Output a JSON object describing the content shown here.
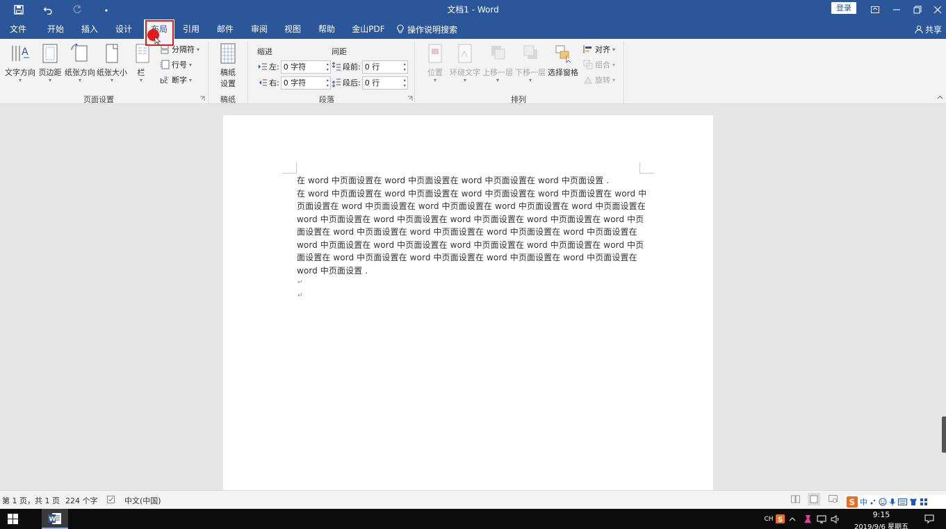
{
  "window": {
    "title": "文档1  -  Word",
    "login_label": "登录"
  },
  "menu_tabs": [
    {
      "label": "文件"
    },
    {
      "label": "开始"
    },
    {
      "label": "插入"
    },
    {
      "label": "设计"
    },
    {
      "label": "布局"
    },
    {
      "label": "引用"
    },
    {
      "label": "邮件"
    },
    {
      "label": "审阅"
    },
    {
      "label": "视图"
    },
    {
      "label": "帮助"
    },
    {
      "label": "金山PDF"
    }
  ],
  "tell_me": "操作说明搜索",
  "share": "共享",
  "ribbon": {
    "page_setup": {
      "group_label": "页面设置",
      "text_direction": "文字方向",
      "margins": "页边距",
      "orientation": "纸张方向",
      "size": "纸张大小",
      "columns": "栏",
      "breaks": "分隔符",
      "line_numbers": "行号",
      "hyphenation": "断字"
    },
    "manuscript": {
      "group_label": "稿纸",
      "button_line1": "稿纸",
      "button_line2": "设置"
    },
    "paragraph": {
      "group_label": "段落",
      "indent_heading": "缩进",
      "spacing_heading": "间距",
      "left_label": "左:",
      "left_value": "0 字符",
      "right_label": "右:",
      "right_value": "0 字符",
      "before_label": "段前:",
      "before_value": "0 行",
      "after_label": "段后:",
      "after_value": "0 行"
    },
    "arrange": {
      "group_label": "排列",
      "position": "位置",
      "wrap_text": "环绕文字",
      "bring_forward": "上移一层",
      "send_backward": "下移一层",
      "selection_pane": "选择窗格",
      "align": "对齐",
      "group": "组合",
      "rotate": "旋转"
    }
  },
  "document": {
    "lines": [
      "在 word 中页面设置在 word 中页面设置在 word 中页面设置在 word 中页面设置 .",
      "在 word 中页面设置在 word 中页面设置在 word 中页面设置在 word 中页面设置在 word 中",
      "页面设置在 word 中页面设置在 word 中页面设置在 word 中页面设置在 word 中页面设置在",
      "word 中页面设置在 word 中页面设置在 word 中页面设置在 word 中页面设置在 word 中页",
      "面设置在 word 中页面设置在 word 中页面设置在 word 中页面设置在 word 中页面设置在",
      "word 中页面设置在 word 中页面设置在 word 中页面设置在 word 中页面设置在 word 中页",
      "面设置在 word 中页面设置在 word 中页面设置在 word 中页面设置在 word 中页面设置在",
      "word 中页面设置 ."
    ],
    "empty_marks": [
      "↵",
      "↵"
    ]
  },
  "status": {
    "page": "第 1 页，共 1 页",
    "words": "224 个字",
    "language": "中文(中国)"
  },
  "ime": {
    "lang": "中"
  },
  "taskbar": {
    "input_indicator": "CH",
    "time": "9:15",
    "date": "2019/9/6 星期五"
  },
  "colors": {
    "accent": "#2b579a",
    "highlight": "#e31a1a"
  }
}
